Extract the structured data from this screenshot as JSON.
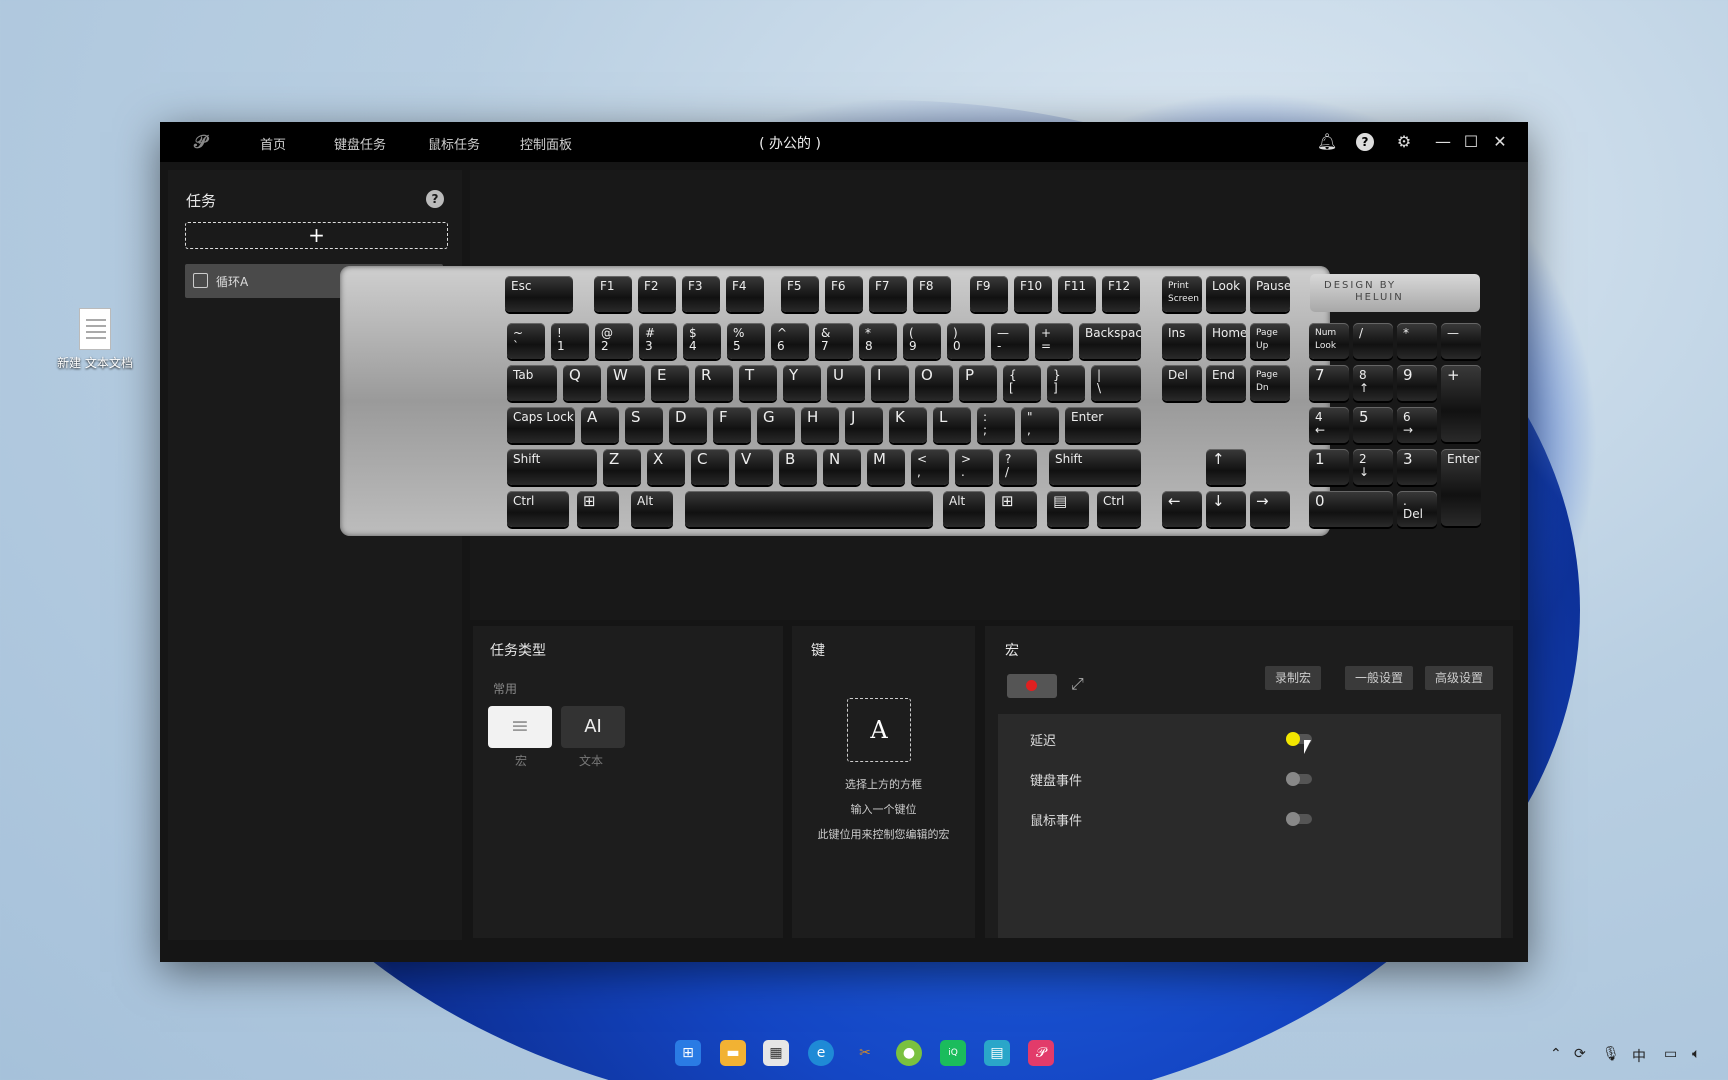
{
  "desktop": {
    "icon_label": "新建 文本文档"
  },
  "window": {
    "nav": [
      "首页",
      "键盘任务",
      "鼠标任务",
      "控制面板"
    ],
    "title": "( 办公的 )"
  },
  "tasks": {
    "header": "任务",
    "add": "+",
    "items": [
      {
        "label": "循环A",
        "checked": false
      }
    ]
  },
  "keyboard": {
    "brand": "DESIGN BY\n      HELUIN",
    "rows": [
      [
        "Esc",
        "F1",
        "F2",
        "F3",
        "F4",
        "F5",
        "F6",
        "F7",
        "F8",
        "F9",
        "F10",
        "F11",
        "F12",
        "Print\nScreen",
        "Look",
        "Pause"
      ],
      [
        "~\n`",
        "!\n1",
        "@\n2",
        "#\n3",
        "$\n4",
        "%\n5",
        "^\n6",
        "&\n7",
        "*\n8",
        "(\n9",
        ")\n0",
        "—\n-",
        "+\n=",
        "Backspace",
        "Ins",
        "Home",
        "Page\nUp",
        "Num\nLook",
        "/",
        "*",
        "—"
      ],
      [
        "Tab",
        "Q",
        "W",
        "E",
        "R",
        "T",
        "Y",
        "U",
        "I",
        "O",
        "P",
        "{\n[",
        "}\n]",
        "|\n\\",
        "Del",
        "End",
        "Page\nDn",
        "7",
        "8\n↑",
        "9",
        "+"
      ],
      [
        "Caps Lock",
        "A",
        "S",
        "D",
        "F",
        "G",
        "H",
        "J",
        "K",
        "L",
        ":\n;",
        "\"\n,",
        "Enter",
        "4\n←",
        "5",
        "6\n→"
      ],
      [
        "Shift",
        "Z",
        "X",
        "C",
        "V",
        "B",
        "N",
        "M",
        "<\n,",
        ">\n.",
        "?\n/",
        "Shift",
        "↑",
        "1",
        "2\n↓",
        "3",
        "Enter"
      ],
      [
        "Ctrl",
        "⊞",
        "Alt",
        "",
        "Alt",
        "⊞",
        "▤",
        "Ctrl",
        "←",
        "↓",
        "→",
        "0",
        ".\nDel"
      ]
    ]
  },
  "task_type": {
    "header": "任务类型",
    "section": "常用",
    "options": [
      {
        "icon": "list-icon",
        "label": "宏"
      },
      {
        "glyph": "AI",
        "label": "文本"
      }
    ]
  },
  "key_panel": {
    "header": "键",
    "key": "A",
    "hints": [
      "选择上方的方框",
      "输入一个键位",
      "此键位用来控制您编辑的宏"
    ]
  },
  "macro": {
    "header": "宏",
    "tabs": [
      "录制宏",
      "一般设置",
      "高级设置"
    ],
    "rows": [
      {
        "label": "延迟",
        "on": true
      },
      {
        "label": "键盘事件",
        "on": false
      },
      {
        "label": "鼠标事件",
        "on": false
      }
    ]
  },
  "taskbar": {
    "ime": "中"
  }
}
